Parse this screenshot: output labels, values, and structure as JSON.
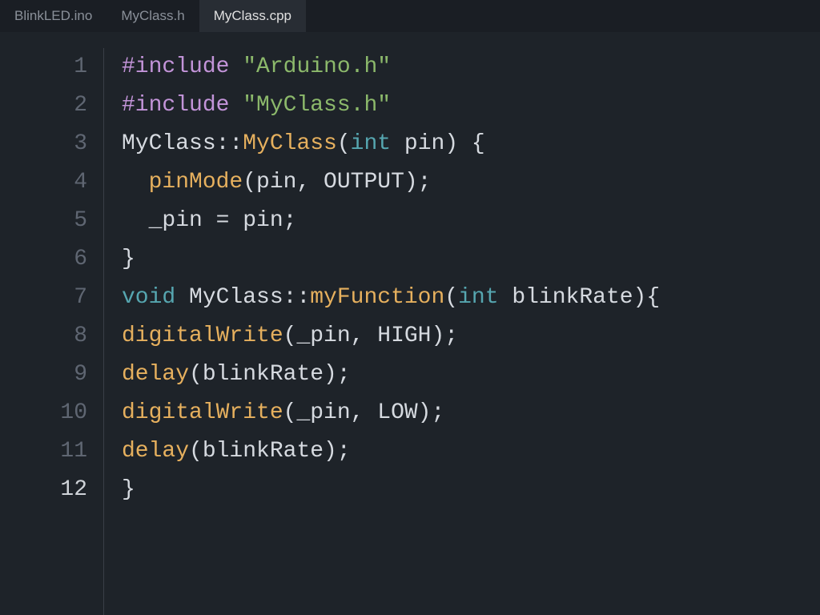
{
  "tabs": [
    {
      "label": "BlinkLED.ino",
      "active": false
    },
    {
      "label": "MyClass.h",
      "active": false
    },
    {
      "label": "MyClass.cpp",
      "active": true
    }
  ],
  "gutter": {
    "start": 1,
    "end": 12,
    "current": 12
  },
  "code": {
    "lines": [
      [
        {
          "cls": "tok-preproc",
          "text": "#include"
        },
        {
          "cls": "tok-ident",
          "text": " "
        },
        {
          "cls": "tok-string",
          "text": "\"Arduino.h\""
        }
      ],
      [
        {
          "cls": "tok-preproc",
          "text": "#include"
        },
        {
          "cls": "tok-ident",
          "text": " "
        },
        {
          "cls": "tok-string",
          "text": "\"MyClass.h\""
        }
      ],
      [
        {
          "cls": "tok-ident",
          "text": "MyClass"
        },
        {
          "cls": "tok-punct",
          "text": "::"
        },
        {
          "cls": "tok-func",
          "text": "MyClass"
        },
        {
          "cls": "tok-punct",
          "text": "("
        },
        {
          "cls": "tok-type",
          "text": "int"
        },
        {
          "cls": "tok-ident",
          "text": " pin"
        },
        {
          "cls": "tok-punct",
          "text": ") {"
        }
      ],
      [
        {
          "cls": "tok-ident",
          "text": "  "
        },
        {
          "cls": "tok-func",
          "text": "pinMode"
        },
        {
          "cls": "tok-punct",
          "text": "(pin, OUTPUT);"
        }
      ],
      [
        {
          "cls": "tok-ident",
          "text": "  _pin "
        },
        {
          "cls": "tok-punct",
          "text": "="
        },
        {
          "cls": "tok-ident",
          "text": " pin"
        },
        {
          "cls": "tok-punct",
          "text": ";"
        }
      ],
      [
        {
          "cls": "tok-punct",
          "text": "}"
        }
      ],
      [
        {
          "cls": "tok-keyword",
          "text": "void"
        },
        {
          "cls": "tok-ident",
          "text": " MyClass"
        },
        {
          "cls": "tok-punct",
          "text": "::"
        },
        {
          "cls": "tok-func",
          "text": "myFunction"
        },
        {
          "cls": "tok-punct",
          "text": "("
        },
        {
          "cls": "tok-type",
          "text": "int"
        },
        {
          "cls": "tok-ident",
          "text": " blinkRate"
        },
        {
          "cls": "tok-punct",
          "text": "){"
        }
      ],
      [
        {
          "cls": "tok-func",
          "text": "digitalWrite"
        },
        {
          "cls": "tok-punct",
          "text": "(_pin, HIGH);"
        }
      ],
      [
        {
          "cls": "tok-func",
          "text": "delay"
        },
        {
          "cls": "tok-punct",
          "text": "(blinkRate);"
        }
      ],
      [
        {
          "cls": "tok-func",
          "text": "digitalWrite"
        },
        {
          "cls": "tok-punct",
          "text": "(_pin, LOW);"
        }
      ],
      [
        {
          "cls": "tok-func",
          "text": "delay"
        },
        {
          "cls": "tok-punct",
          "text": "(blinkRate);"
        }
      ],
      [
        {
          "cls": "tok-punct",
          "text": "}"
        }
      ]
    ]
  }
}
